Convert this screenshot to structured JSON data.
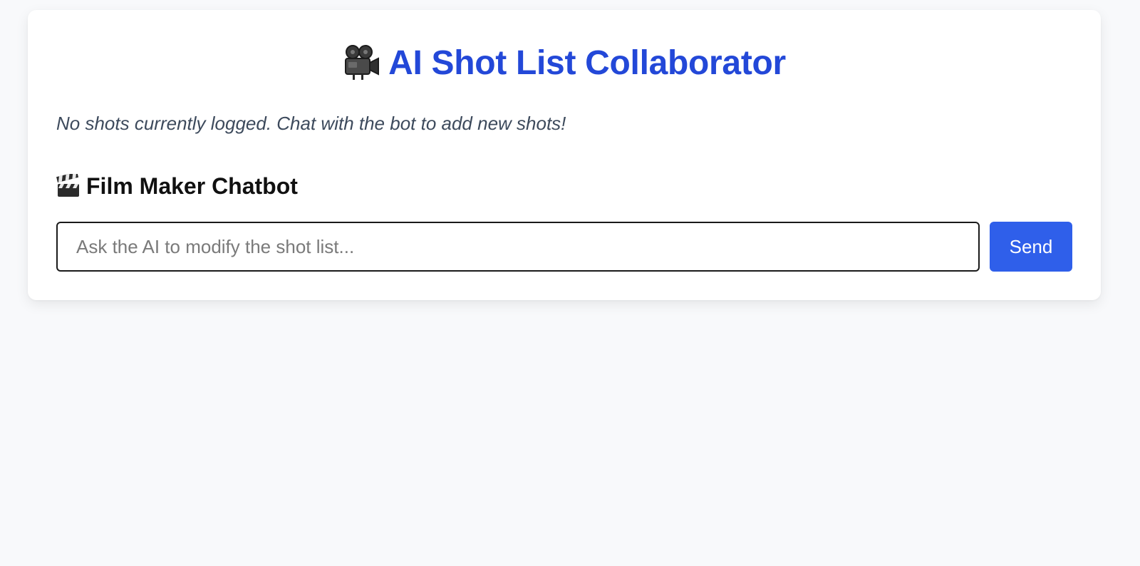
{
  "header": {
    "title": "AI Shot List Collaborator",
    "icon": "movie-camera-icon"
  },
  "shot_list": {
    "empty_message": "No shots currently logged. Chat with the bot to add new shots!"
  },
  "chatbot": {
    "title": "Film Maker Chatbot",
    "icon": "clapperboard-icon",
    "input_placeholder": "Ask the AI to modify the shot list...",
    "input_value": "",
    "send_label": "Send"
  },
  "colors": {
    "accent": "#2348d8",
    "button": "#2f5fea",
    "background": "#f8f9fb",
    "card": "#ffffff",
    "muted_text": "#3d4a5c"
  }
}
